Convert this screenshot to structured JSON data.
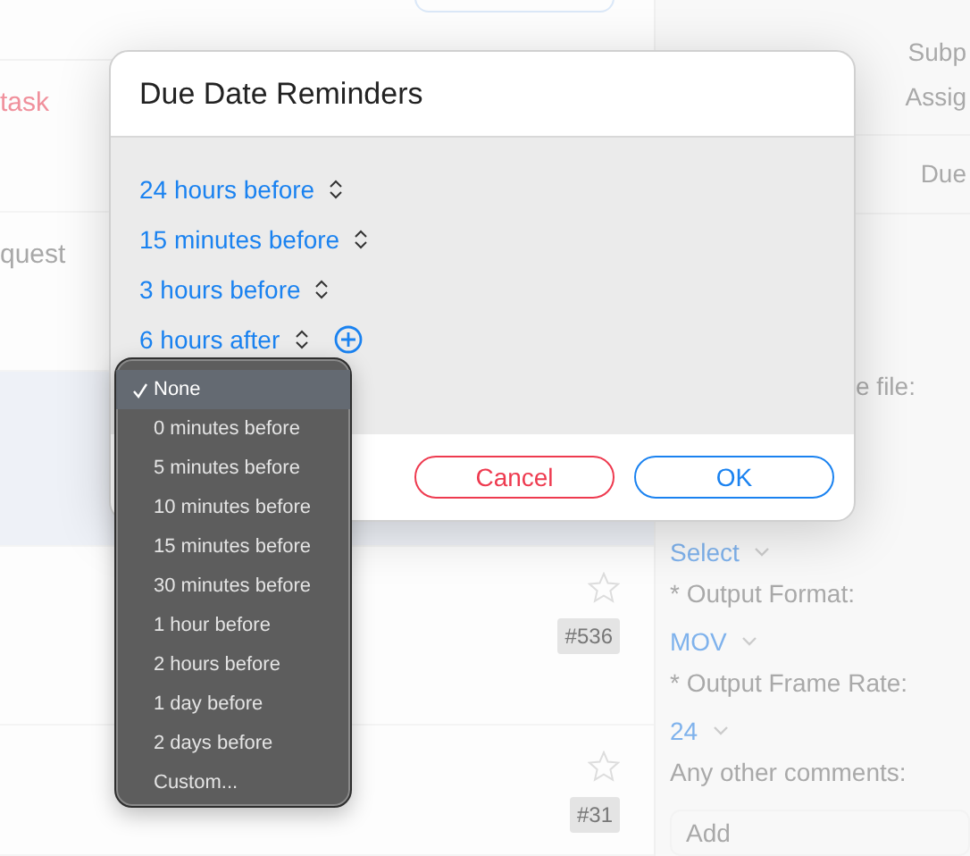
{
  "background": {
    "list_rows": [
      {
        "title": "task",
        "color": "#f0909c",
        "selected": false
      },
      {
        "title": "quest",
        "color": "#a8a8a8",
        "selected": false
      },
      {
        "selected": true
      },
      {
        "tag": "#536",
        "selected": false
      },
      {
        "tag": "#31",
        "selected": false
      }
    ],
    "detail": {
      "header_labels": [
        "Subp",
        "Assig"
      ],
      "due_label": "Due",
      "file_label": "e file:",
      "fields": [
        {
          "kind": "select",
          "text": "Select"
        },
        {
          "kind": "label",
          "text": "* Output Format:"
        },
        {
          "kind": "select",
          "text": "MOV"
        },
        {
          "kind": "label",
          "text": "* Output Frame Rate:"
        },
        {
          "kind": "select",
          "text": "24"
        },
        {
          "kind": "label",
          "text": "Any other comments:"
        },
        {
          "kind": "input",
          "placeholder": "Add"
        }
      ]
    }
  },
  "dialog": {
    "title": "Due Date Reminders",
    "reminders": [
      "24 hours before",
      "15 minutes before",
      "3 hours before",
      "6 hours after"
    ],
    "buttons": [
      {
        "label": "Cancel",
        "kind": "cancel"
      },
      {
        "label": "OK",
        "kind": "ok"
      }
    ]
  },
  "menu": {
    "items": [
      {
        "label": "None",
        "selected": true
      },
      {
        "label": "0 minutes before",
        "selected": false
      },
      {
        "label": "5 minutes before",
        "selected": false
      },
      {
        "label": "10 minutes before",
        "selected": false
      },
      {
        "label": "15 minutes before",
        "selected": false
      },
      {
        "label": "30 minutes before",
        "selected": false
      },
      {
        "label": "1 hour before",
        "selected": false
      },
      {
        "label": "2 hours before",
        "selected": false
      },
      {
        "label": "1 day before",
        "selected": false
      },
      {
        "label": "2 days before",
        "selected": false
      },
      {
        "label": "Custom...",
        "selected": false
      }
    ]
  }
}
